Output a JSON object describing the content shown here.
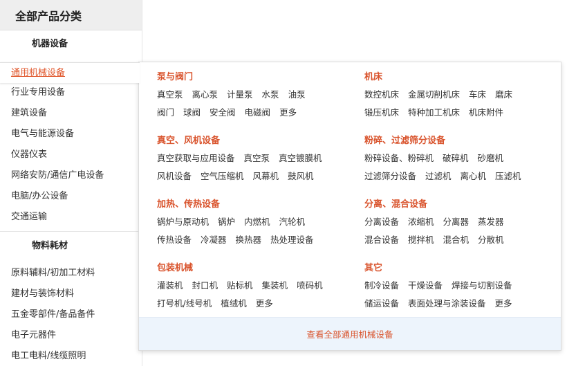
{
  "sidebar": {
    "header": "全部产品分类",
    "group1_title": "机器设备",
    "group1_items": [
      "通用机械设备",
      "行业专用设备",
      "建筑设备",
      "电气与能源设备",
      "仪器仪表",
      "网络安防/通信广电设备",
      "电脑/办公设备",
      "交通运输"
    ],
    "group2_title": "物料耗材",
    "group2_items": [
      "原料辅料/初加工材料",
      "建材与装饰材料",
      "五金零部件/备品备件",
      "电子元器件",
      "电工电料/线缆照明"
    ]
  },
  "flyout": {
    "sections": [
      {
        "title": "泵与阀门",
        "rows": [
          [
            "真空泵",
            "离心泵",
            "计量泵",
            "水泵",
            "油泵"
          ],
          [
            "阀门",
            "球阀",
            "安全阀",
            "电磁阀",
            "更多"
          ]
        ]
      },
      {
        "title": "机床",
        "rows": [
          [
            "数控机床",
            "金属切削机床",
            "车床",
            "磨床"
          ],
          [
            "锻压机床",
            "特种加工机床",
            "机床附件"
          ]
        ]
      },
      {
        "title": "真空、风机设备",
        "rows": [
          [
            "真空获取与应用设备",
            "真空泵",
            "真空镀膜机"
          ],
          [
            "风机设备",
            "空气压缩机",
            "风幕机",
            "鼓风机"
          ]
        ]
      },
      {
        "title": "粉碎、过滤筛分设备",
        "rows": [
          [
            "粉碎设备、粉碎机",
            "破碎机",
            "砂磨机"
          ],
          [
            "过滤筛分设备",
            "过滤机",
            "离心机",
            "压滤机"
          ]
        ]
      },
      {
        "title": "加热、传热设备",
        "rows": [
          [
            "锅炉与原动机",
            "锅炉",
            "内燃机",
            "汽轮机"
          ],
          [
            "传热设备",
            "冷凝器",
            "换热器",
            "热处理设备"
          ]
        ]
      },
      {
        "title": "分离、混合设备",
        "rows": [
          [
            "分离设备",
            "浓缩机",
            "分离器",
            "蒸发器"
          ],
          [
            "混合设备",
            "搅拌机",
            "混合机",
            "分散机"
          ]
        ]
      },
      {
        "title": "包装机械",
        "rows": [
          [
            "灌装机",
            "封口机",
            "贴标机",
            "集装机",
            "喷码机"
          ],
          [
            "打号机/线号机",
            "植绒机",
            "更多"
          ]
        ]
      },
      {
        "title": "其它",
        "rows": [
          [
            "制冷设备",
            "干燥设备",
            "焊接与切割设备"
          ],
          [
            "储运设备",
            "表面处理与涂装设备",
            "更多"
          ]
        ]
      }
    ],
    "footer_link": "查看全部通用机械设备"
  },
  "colors": {
    "accent": "#d9532c",
    "footer_bg": "#edf4fc",
    "header_bg": "#eeeeee"
  }
}
